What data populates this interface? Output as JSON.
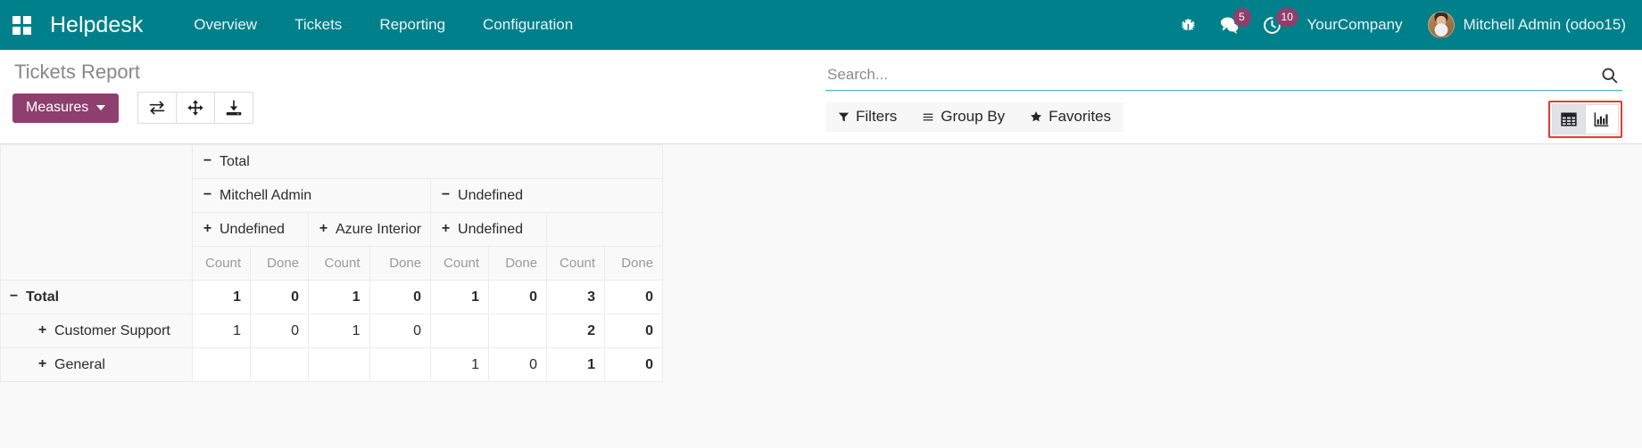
{
  "navbar": {
    "apps_icon": "apps-grid-icon",
    "brand": "Helpdesk",
    "menu": [
      {
        "label": "Overview"
      },
      {
        "label": "Tickets"
      },
      {
        "label": "Reporting"
      },
      {
        "label": "Configuration"
      }
    ],
    "systray": {
      "debug_icon": "bug-icon",
      "messages_icon": "messages-icon",
      "messages_count": "5",
      "activities_icon": "activity-clock-icon",
      "activities_count": "10",
      "company": "YourCompany",
      "user": "Mitchell Admin (odoo15)",
      "badge_color": "#8f3f6d",
      "navbar_color": "#00808a"
    }
  },
  "control_panel": {
    "title": "Tickets Report",
    "measures_label": "Measures",
    "icon_buttons": [
      {
        "name": "flip-axis-button",
        "icon": "flip-axis-icon"
      },
      {
        "name": "expand-all-button",
        "icon": "expand-all-icon"
      },
      {
        "name": "download-xlsx-button",
        "icon": "download-icon"
      }
    ],
    "search": {
      "value": "",
      "placeholder": "Search...",
      "icon": "search-icon"
    },
    "facets": [
      {
        "icon": "filter-icon",
        "label": "Filters"
      },
      {
        "icon": "bars-icon",
        "label": "Group By"
      },
      {
        "icon": "star-icon",
        "label": "Favorites"
      }
    ],
    "views": [
      {
        "name": "pivot-view-button",
        "icon": "table-icon",
        "active": true
      },
      {
        "name": "graph-view-button",
        "icon": "bar-chart-icon",
        "active": false
      }
    ],
    "highlight_color": "#e83a2f"
  },
  "pivot": {
    "col_header_rows": [
      [
        {
          "toggle": "−",
          "label": "Total",
          "span": 8
        }
      ],
      [
        {
          "toggle": "−",
          "label": "Mitchell Admin",
          "span": 4
        },
        {
          "toggle": "−",
          "label": "Undefined",
          "span": 4
        }
      ],
      [
        {
          "toggle": "+",
          "label": "Undefined",
          "span": 2
        },
        {
          "toggle": "+",
          "label": "Azure Interior",
          "span": 2
        },
        {
          "toggle": "+",
          "label": "Undefined",
          "span": 2
        },
        {
          "toggle": "",
          "label": "",
          "span": 2
        }
      ]
    ],
    "measures": [
      "Count",
      "Done",
      "Count",
      "Done",
      "Count",
      "Done",
      "Count",
      "Done"
    ],
    "rows": [
      {
        "toggle": "−",
        "label": "Total",
        "level": 0,
        "total": true,
        "values": [
          "1",
          "0",
          "1",
          "0",
          "1",
          "0",
          "3",
          "0"
        ]
      },
      {
        "toggle": "+",
        "label": "Customer Support",
        "level": 1,
        "total": false,
        "values": [
          "1",
          "0",
          "1",
          "0",
          "",
          "",
          "2",
          "0"
        ]
      },
      {
        "toggle": "+",
        "label": "General",
        "level": 1,
        "total": false,
        "values": [
          "",
          "",
          "",
          "",
          "1",
          "0",
          "1",
          "0"
        ]
      }
    ]
  }
}
